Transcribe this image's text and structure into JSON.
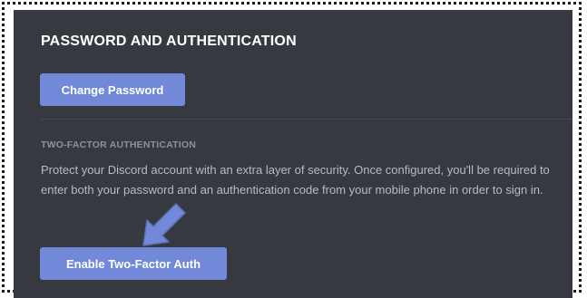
{
  "section": {
    "title": "PASSWORD AND AUTHENTICATION",
    "change_password_label": "Change Password"
  },
  "two_factor": {
    "label": "TWO-FACTOR AUTHENTICATION",
    "description": "Protect your Discord account with an extra layer of security. Once configured, you'll be required to enter both your password and an authentication code from your mobile phone in order to sign in.",
    "enable_label": "Enable Two-Factor Auth"
  },
  "colors": {
    "panel_background": "#36393f",
    "button_blurple": "#7289da",
    "title_text": "#ffffff",
    "body_text": "#b9bbbe",
    "label_text": "#8e9297",
    "arrow_annotation": "#7289da"
  },
  "icons": {
    "annotation": "pointer-arrow-icon"
  }
}
